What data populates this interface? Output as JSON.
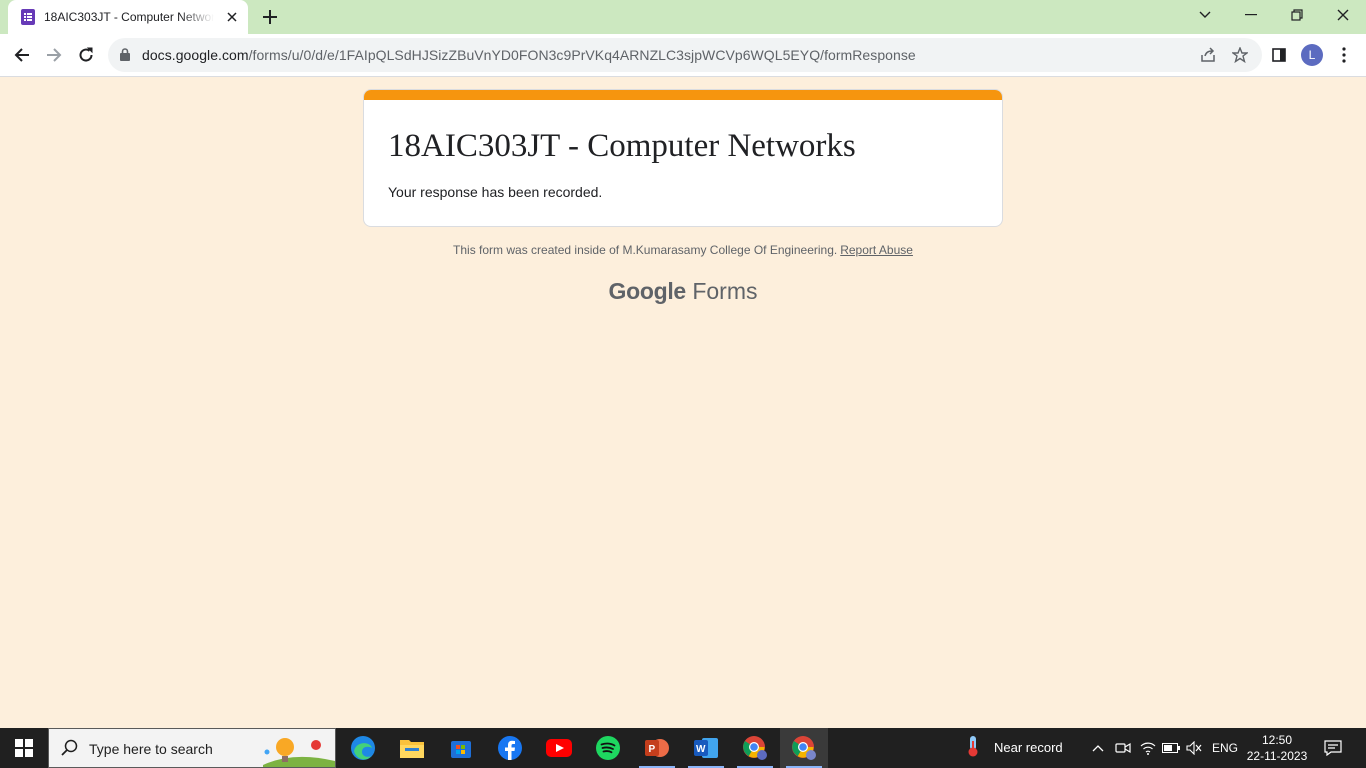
{
  "browser": {
    "tab": {
      "title": "18AIC303JT - Computer Networks"
    },
    "url_host": "docs.google.com",
    "url_path": "/forms/u/0/d/e/1FAIpQLSdHJSizZBuVnYD0FON3c9PrVKq4ARNZLC3sjpWCVp6WQL5EYQ/formResponse",
    "profile_initial": "L"
  },
  "form": {
    "title": "18AIC303JT - Computer Networks",
    "message": "Your response has been recorded.",
    "footer_note": "This form was created inside of M.Kumarasamy College Of Engineering.",
    "report_link": "Report Abuse",
    "brand_google": "Google",
    "brand_forms": "Forms",
    "accent_color": "#f6950e"
  },
  "taskbar": {
    "search_placeholder": "Type here to search",
    "weather": "Near record",
    "language": "ENG",
    "time": "12:50",
    "date": "22-11-2023"
  }
}
